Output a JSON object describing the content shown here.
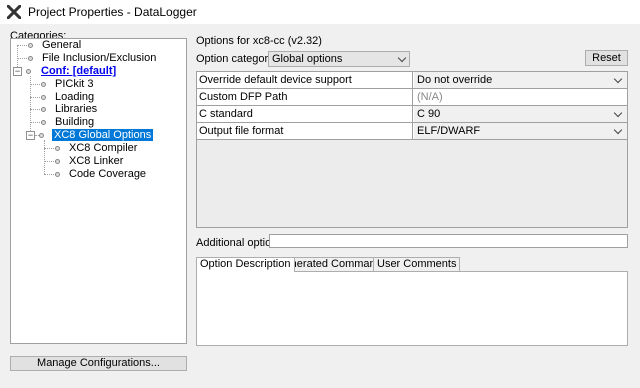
{
  "window": {
    "title": "Project Properties - DataLogger"
  },
  "categories_label": "Categories:",
  "tree": {
    "general": "General",
    "file_inclusion": "File Inclusion/Exclusion",
    "conf": "Conf: [default]",
    "pickit": "PICkit 3",
    "loading": "Loading",
    "libraries": "Libraries",
    "building": "Building",
    "xc8_global": "XC8 Global Options",
    "xc8_compiler": "XC8 Compiler",
    "xc8_linker": "XC8 Linker",
    "code_coverage": "Code Coverage"
  },
  "manage_button": "Manage Configurations...",
  "options_title": "Options for xc8-cc (v2.32)",
  "option_categories_label": "Option categories:",
  "option_categories_value": "Global options",
  "reset_button": "Reset",
  "grid": {
    "rows": [
      {
        "key": "Override default device support",
        "value": "Do not override"
      },
      {
        "key": "Custom DFP Path",
        "value": "(N/A)"
      },
      {
        "key": "C standard",
        "value": "C 90"
      },
      {
        "key": "Output file format",
        "value": "ELF/DWARF"
      }
    ]
  },
  "additional_options_label": "Additional options:",
  "additional_options_value": "",
  "tabs": [
    "Option Description",
    "Generated Command Line",
    "User Comments"
  ],
  "colors": {
    "selection": "#0078d7",
    "link": "#0000ee"
  },
  "icons": {
    "app": "x-logo-icon"
  }
}
